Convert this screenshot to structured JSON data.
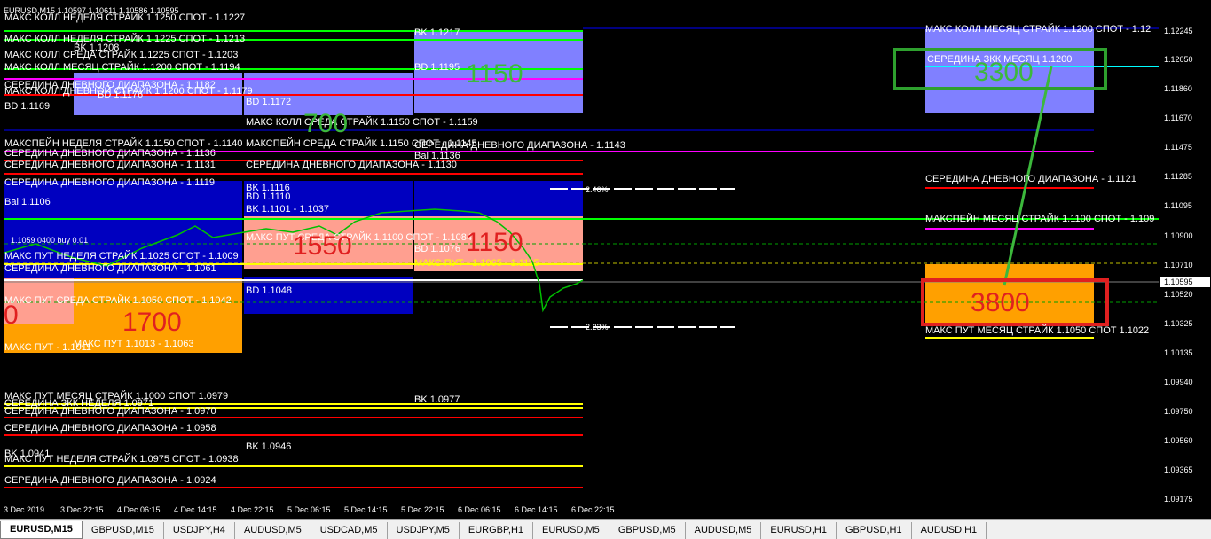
{
  "window": {
    "title": "EURUSD,M15  1.10597 1.10611 1.10586 1.10595"
  },
  "price_axis": {
    "ticks": [
      "1.12245",
      "1.12050",
      "1.11860",
      "1.11670",
      "1.11475",
      "1.11285",
      "1.11095",
      "1.10900",
      "1.10710",
      "1.10520",
      "1.10325",
      "1.10135",
      "1.09940",
      "1.09750",
      "1.09560",
      "1.09365",
      "1.09175"
    ],
    "current_price": "1.10595"
  },
  "time_axis": [
    "3 Dec 2019",
    "3 Dec 22:15",
    "4 Dec 06:15",
    "4 Dec 14:15",
    "4 Dec 22:15",
    "5 Dec 06:15",
    "5 Dec 14:15",
    "5 Dec 22:15",
    "6 Dec 06:15",
    "6 Dec 14:15",
    "6 Dec 22:15"
  ],
  "tabs": [
    "EURUSD,M15",
    "GBPUSD,M15",
    "USDJPY,H4",
    "AUDUSD,M5",
    "USDCAD,M5",
    "USDJPY,M5",
    "EURGBP,H1",
    "EURUSD,M5",
    "GBPUSD,M5",
    "AUDUSD,M5",
    "EURUSD,H1",
    "GBPUSD,H1",
    "AUDUSD,H1"
  ],
  "labels": {
    "week_call": "МАКС КОЛЛ НЕДЕЛЯ  СТРАЙК 1.1250 СПОТ - 1.1227",
    "week_call2": "МАКС КОЛЛ НЕДЕЛЯ СТРАЙК 1.1225 СПОТ - 1.1213",
    "wed_call": "МАКС КОЛЛ СРЕДА  СТРАЙК 1.1225 СПОТ - 1.1203",
    "month_call_left": "МАКС КОЛЛ МЕСЯЦ СТРАЙК 1.1200 СПОТ - 1.1194",
    "mid_day_1182": "СЕРЕДИНА ДНЕВНОГО ДИАПАЗОНА - 1.1182",
    "mon_call": "МАКС КОЛЛ ДНЕВНОЙ СТРАЙК 1.1200 СПОТ - 1.1179",
    "bd_1169": "BD 1.1169",
    "bd_1176": "BD 1.1176",
    "bd_1172": "BD 1.1172",
    "wed_call_1159": "МАКС КОЛЛ СРЕДА  СТРАЙК 1.1150 СПОТ - 1.1159",
    "week_pain": "МАКСПЕЙН НЕДЕЛЯ  СТРАЙК 1.1150 СПОТ - 1.1140",
    "wed_pain": "МАКСПЕЙН СРЕДА  СТРАЙК 1.1150 СПОТ - 1.1145",
    "mid_1143": "СЕРЕДИНА ДНЕВНОГО ДИАПАЗОНА - 1.1143",
    "mid_1136": "СЕРЕДИНА ДНЕВНОГО ДИАПАЗОНА - 1.1136",
    "mid_1131": "СЕРЕДИНА ДНЕВНОГО ДИАПАЗОНА - 1.1131",
    "mid_1130": "СЕРЕДИНА ДНЕВНОГО ДИАПАЗОНА - 1.1130",
    "mid_1119": "СЕРЕДИНА ДНЕВНОГО ДИАПАЗОНА - 1.1119",
    "bk_1116": "BK 1.1116",
    "bd_1110": "BD 1.1110",
    "ba_1136": "Bal 1.1136",
    "bk_1101": "BK 1.1101 - 1.1037",
    "bd_1106": "Bal 1.1106",
    "wed_put": "МАКС ПУТ СРЕДА  СТРАЙК 1.1100 СПОТ - 1.1084",
    "bd_1076": "BD 1.1076",
    "put_1065": "МАКС ПУТ - 1.1065 - 1.1115",
    "buy_note": "1.1059 0400 buy 0.01",
    "week_put": "МАКС ПУТ НЕДЕЛЯ  СТРАЙК 1.1025 СПОТ - 1.1009",
    "mid_left_dup": "СЕРЕДИНА ДНЕВНОГО ДИАПАЗОНА - 1.1061",
    "bd_1048": "BD 1.1048",
    "wed_put2": "МАКС ПУТ СРЕДА  СТРАЙК 1.1050  СПОТ - 1.1042",
    "put_left": "МАКС ПУТ - 1.1011",
    "put_1013": "МАКС ПУТ 1.1013 - 1.1063",
    "month_put": "МАКС ПУТ МЕСЯЦ  СТРАЙК 1.1000 СПОТ 1.0979",
    "mid_1976": "СЕРЕДИНА ЗКК НЕДЕЛЯ 1.0971",
    "mid_1970": "СЕРЕДИНА ДНЕВНОГО ДИАПАЗОНА - 1.0970",
    "bk_0977": "BK 1.0977",
    "mid_0958": "СЕРЕДИНА ДНЕВНОГО ДИАПАЗОНА - 1.0958",
    "bk_0946": "BK 1.0946",
    "bk_0941": "BK 1.0941",
    "week_put2": "МАКС ПУТ НЕДЕЛЯ СТРАЙК 1.0975 СПОТ - 1.0938",
    "mid_0924": "СЕРЕДИНА ДНЕВНОГО ДИАПАЗОНА - 1.0924",
    "bk_1217": "BK 1.1217",
    "bd_1195": "BD 1.1195",
    "bk_1208": "BK 1.1208",
    "right_month_call": "МАКС КОЛЛ МЕСЯЦ СТРАЙК 1.1200 СПОТ - 1.12",
    "right_mid_zkk": "СЕРЕДИНА ЗКК МЕСЯЦ 1.1200",
    "right_mid_1121": "СЕРЕДИНА ДНЕВНОГО ДИАПАЗОНА - 1.1121",
    "right_pain": "МАКСПЕЙН МЕСЯЦ  СТРАЙК 1.1100 СПОТ - 1.109",
    "right_put": "МАКС ПУТ МЕСЯЦ  СТРАЙК 1.1050 СПОТ 1.1022",
    "pct_top": "2.46%",
    "pct_bottom": "2.23%"
  },
  "big_numbers": {
    "n3300": "3300",
    "n3800": "3800",
    "n1700": "1700",
    "n1550": "1550",
    "n1150": "1150",
    "n1150b": "1150",
    "n700": "700",
    "n0": "0"
  }
}
